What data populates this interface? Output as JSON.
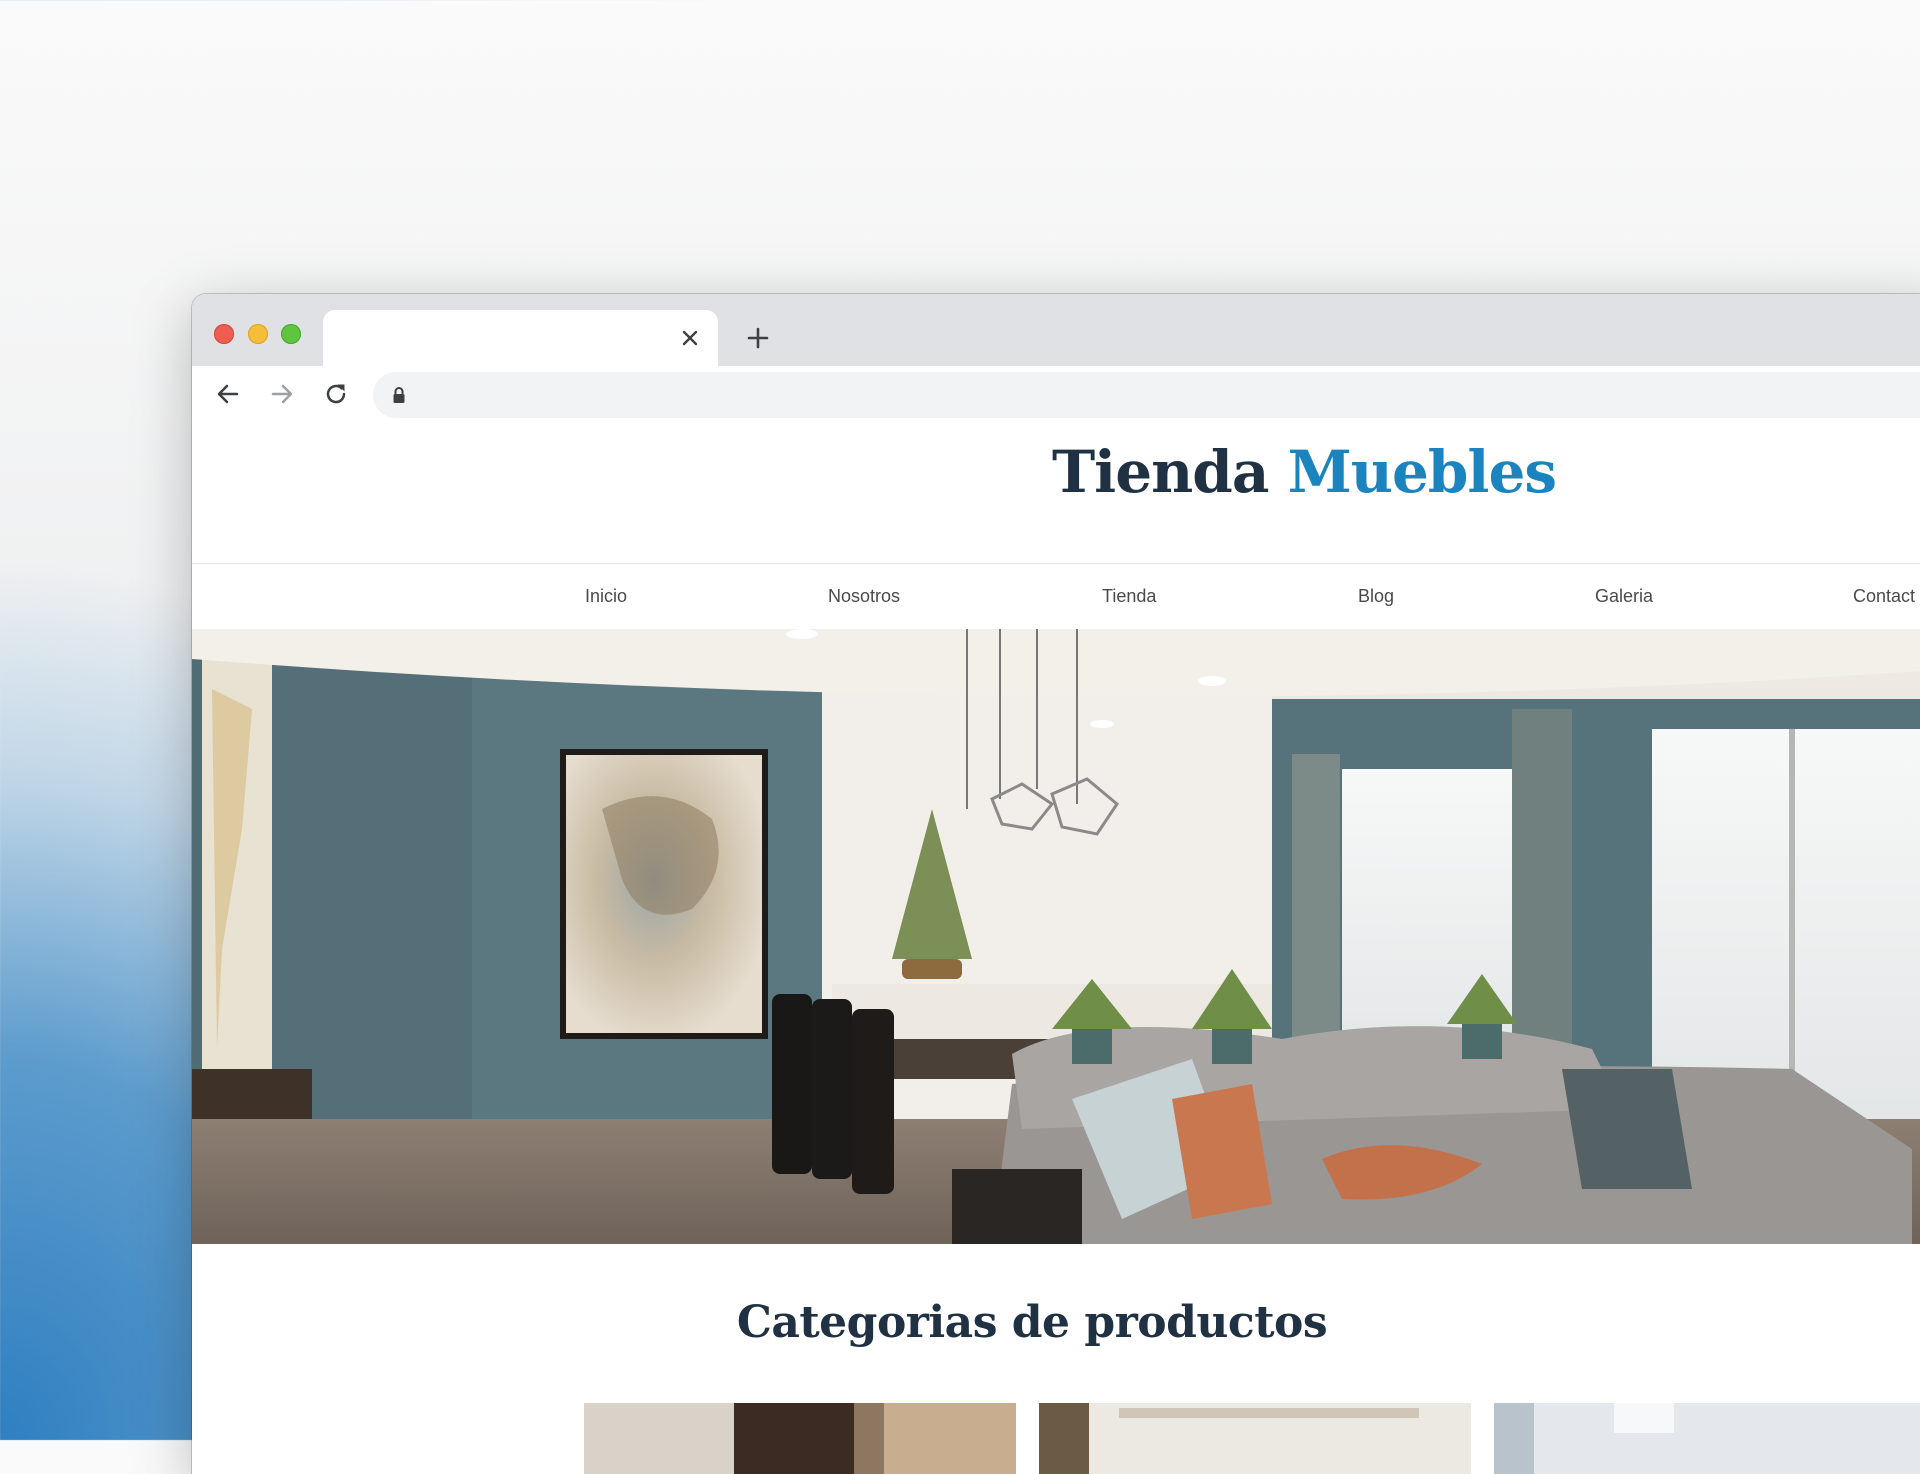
{
  "browser": {
    "tab_title": "",
    "url": "",
    "window_controls": [
      "close-light",
      "minimize-light",
      "maximize-light"
    ],
    "icons": [
      "close-icon",
      "plus-icon",
      "back-arrow-icon",
      "forward-arrow-icon",
      "reload-icon",
      "lock-icon"
    ]
  },
  "site": {
    "brand_part1": "Tienda",
    "brand_part2": "Muebles",
    "brand_colors": {
      "dark": "#1f3142",
      "accent": "#1b84bf"
    },
    "nav": [
      "Inicio",
      "Nosotros",
      "Tienda",
      "Blog",
      "Galeria",
      "Contact"
    ],
    "section_title": "Categorias de productos"
  }
}
